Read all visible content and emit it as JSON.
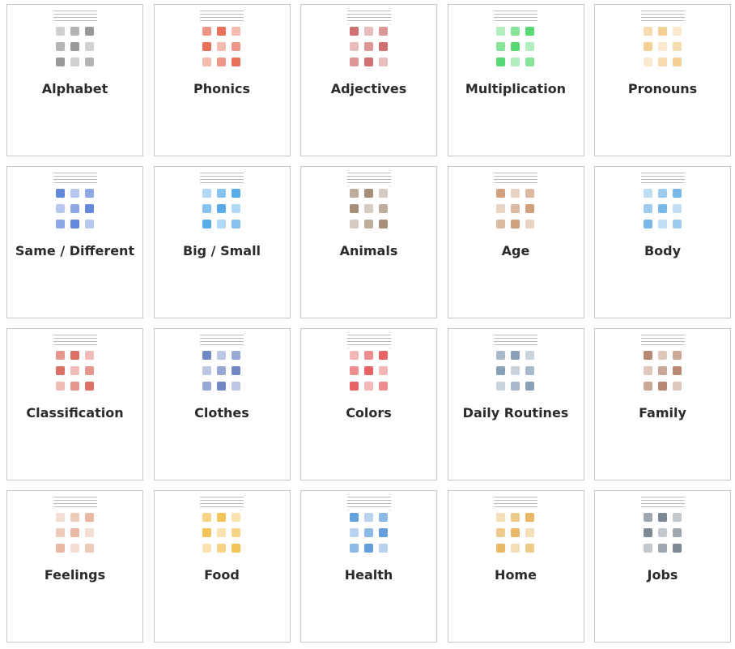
{
  "categories": [
    {
      "label": "Alphabet",
      "accent": "#777777"
    },
    {
      "label": "Phonics",
      "accent": "#e04020"
    },
    {
      "label": "Adjectives",
      "accent": "#c04040"
    },
    {
      "label": "Multiplication",
      "accent": "#22cc44"
    },
    {
      "label": "Pronouns",
      "accent": "#f0c070"
    },
    {
      "label": "Same / Different",
      "accent": "#3060d0"
    },
    {
      "label": "Big / Small",
      "accent": "#2090e0"
    },
    {
      "label": "Animals",
      "accent": "#8a6a4a"
    },
    {
      "label": "Age",
      "accent": "#c08050"
    },
    {
      "label": "Body",
      "accent": "#4aa0e0"
    },
    {
      "label": "Classification",
      "accent": "#d04030"
    },
    {
      "label": "Clothes",
      "accent": "#4060b0"
    },
    {
      "label": "Colors",
      "accent": "#e03030"
    },
    {
      "label": "Daily Routines",
      "accent": "#6080a0"
    },
    {
      "label": "Family",
      "accent": "#a06040"
    },
    {
      "label": "Feelings",
      "accent": "#e0a080"
    },
    {
      "label": "Food",
      "accent": "#f0b020"
    },
    {
      "label": "Health",
      "accent": "#3080d0"
    },
    {
      "label": "Home",
      "accent": "#e0a030"
    },
    {
      "label": "Jobs",
      "accent": "#506070"
    }
  ]
}
